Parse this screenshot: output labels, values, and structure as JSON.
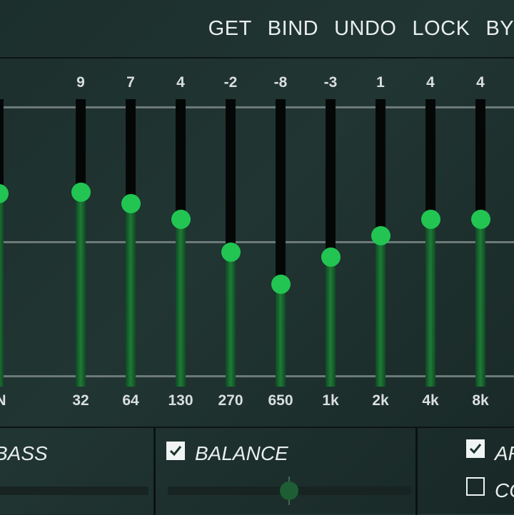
{
  "toolbar": {
    "buttons": [
      {
        "label": "GET"
      },
      {
        "label": "BIND"
      },
      {
        "label": "UNDO"
      },
      {
        "label": "LOCK"
      },
      {
        "label": "BYP"
      }
    ]
  },
  "equalizer": {
    "range": [
      -15,
      15
    ],
    "bands": [
      {
        "freq": "IN",
        "value": null,
        "level_fraction": 0.67
      },
      {
        "freq": "32",
        "value": "9"
      },
      {
        "freq": "64",
        "value": "7"
      },
      {
        "freq": "130",
        "value": "4"
      },
      {
        "freq": "270",
        "value": "-2"
      },
      {
        "freq": "650",
        "value": "-8"
      },
      {
        "freq": "1k",
        "value": "-3"
      },
      {
        "freq": "2k",
        "value": "1"
      },
      {
        "freq": "4k",
        "value": "4"
      },
      {
        "freq": "8k",
        "value": "4"
      }
    ],
    "colors": {
      "knob": "#22c552",
      "fill": "#1f7a38",
      "track": "#050707"
    }
  },
  "options": {
    "bass": {
      "label": "BASS",
      "level_fraction": 0.0
    },
    "balance": {
      "label": "BALANCE",
      "checked": true,
      "level_fraction": 0.5
    },
    "ar": {
      "label": "AR",
      "checked": true
    },
    "co": {
      "label": "CO",
      "checked": false
    }
  }
}
